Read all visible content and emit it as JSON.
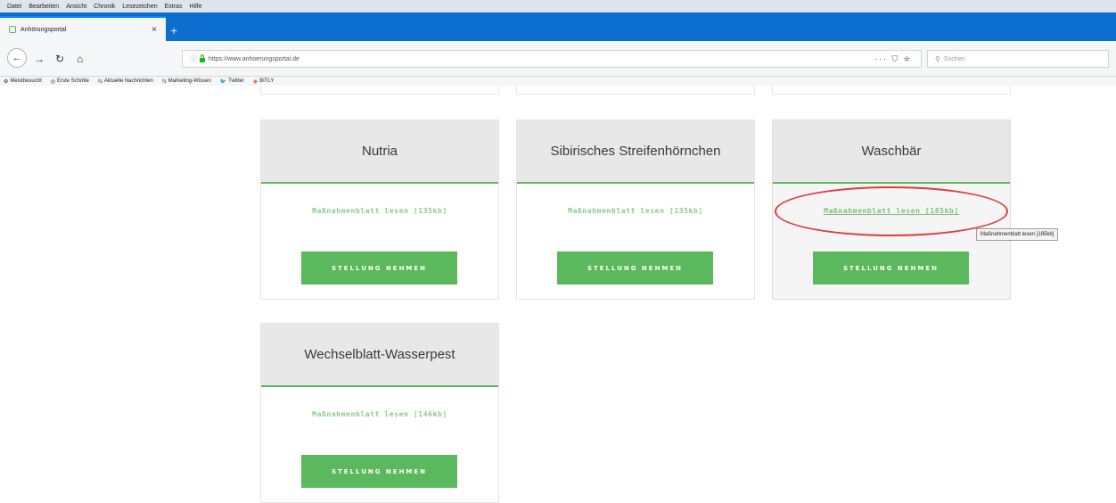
{
  "browser": {
    "menu": [
      "Datei",
      "Bearbeiten",
      "Ansicht",
      "Chronik",
      "Lesezeichen",
      "Extras",
      "Hilfe"
    ],
    "tab_title": "Anhörungsportal",
    "tab_close": "×",
    "new_tab": "+",
    "url": "https://www.anhoerungsportal.de",
    "url_actions": "··· ⛉ ☆",
    "search_placeholder": "Suchen",
    "bookmarks": [
      {
        "icon": "⚙",
        "label": "Meistbesucht"
      },
      {
        "icon": "◎",
        "label": "Erste Schritte"
      },
      {
        "icon": "ℕ",
        "label": "Aktuelle Nachrichten"
      },
      {
        "icon": "ℕ",
        "label": "Marketing-Wissen"
      },
      {
        "icon": "🐦",
        "label": "Twitter"
      },
      {
        "icon": "◉",
        "label": "BITLY"
      }
    ],
    "accent_color": "#0c6ecf"
  },
  "cards": [
    {
      "title": "Nutria",
      "link": "Maßnahmenblatt lesen [135kb]",
      "button": "STELLUNG NEHMEN"
    },
    {
      "title": "Sibirisches Streifenhörnchen",
      "link": "Maßnahmenblatt lesen [135kb]",
      "button": "STELLUNG NEHMEN"
    },
    {
      "title": "Waschbär",
      "link": "Maßnahmenblatt lesen [185kb]",
      "button": "STELLUNG NEHMEN"
    },
    {
      "title": "Wechselblatt-Wasserpest",
      "link": "Maßnahmenblatt lesen [146kb]",
      "button": "STELLUNG NEHMEN"
    }
  ],
  "tooltip": "Maßnahmenblatt lesen [185kb]",
  "colors": {
    "primary_green": "#5cb85c",
    "link_green": "#8cc98a",
    "annotation_red": "#e03a3a"
  }
}
